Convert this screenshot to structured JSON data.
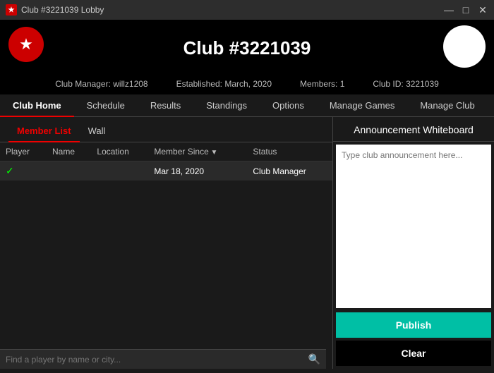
{
  "titleBar": {
    "icon": "★",
    "title": "Club #3221039 Lobby",
    "controls": [
      "—",
      "□",
      "✕"
    ]
  },
  "header": {
    "clubName": "Club #3221039",
    "avatarAlt": "User avatar"
  },
  "infoBar": {
    "manager": "Club Manager: willz1208",
    "established": "Established: March, 2020",
    "members": "Members: 1",
    "clubId": "Club ID: 3221039"
  },
  "navTabs": [
    {
      "label": "Club Home",
      "active": true
    },
    {
      "label": "Schedule",
      "active": false
    },
    {
      "label": "Results",
      "active": false
    },
    {
      "label": "Standings",
      "active": false
    },
    {
      "label": "Options",
      "active": false
    },
    {
      "label": "Manage Games",
      "active": false
    },
    {
      "label": "Manage Club",
      "active": false
    }
  ],
  "subTabs": [
    {
      "label": "Member List",
      "active": true
    },
    {
      "label": "Wall",
      "active": false
    }
  ],
  "memberTable": {
    "columns": [
      {
        "label": "Player",
        "sortable": false
      },
      {
        "label": "Name",
        "sortable": false
      },
      {
        "label": "Location",
        "sortable": false
      },
      {
        "label": "Member Since",
        "sortable": true
      },
      {
        "label": "Status",
        "sortable": false
      }
    ],
    "rows": [
      {
        "check": "✓",
        "player": "",
        "name": "",
        "location": "",
        "memberSince": "Mar 18, 2020",
        "status": "Club Manager",
        "selected": true
      }
    ]
  },
  "searchBar": {
    "placeholder": "Find a player by name or city...",
    "icon": "🔍"
  },
  "announcement": {
    "title": "Announcement Whiteboard",
    "placeholder": "Type club announcement here...",
    "publishLabel": "Publish",
    "clearLabel": "Clear"
  }
}
